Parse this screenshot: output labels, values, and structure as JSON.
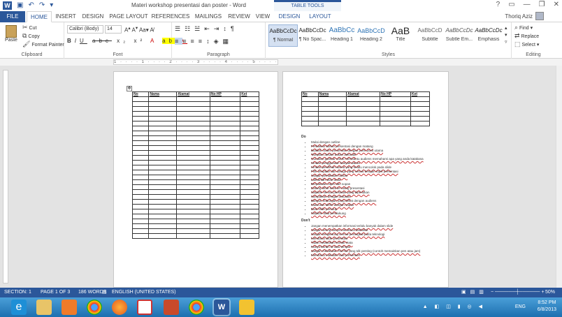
{
  "window": {
    "title": "Materi workshop presentasi dan poster - Word",
    "contextual_tab_group": "TABLE TOOLS",
    "controls": [
      "?",
      "▭",
      "—",
      "❐",
      "✕"
    ]
  },
  "qat": [
    "save-icon",
    "undo-icon",
    "redo-icon",
    "customize-icon"
  ],
  "tabs": {
    "file": "FILE",
    "items": [
      "HOME",
      "INSERT",
      "DESIGN",
      "PAGE LAYOUT",
      "REFERENCES",
      "MAILINGS",
      "REVIEW",
      "VIEW"
    ],
    "contextual": [
      "DESIGN",
      "LAYOUT"
    ]
  },
  "user": {
    "name": "Thoriq Aziz"
  },
  "clipboard": {
    "paste": "Paste",
    "cut": "Cut",
    "copy": "Copy",
    "format_painter": "Format Painter",
    "label": "Clipboard"
  },
  "font": {
    "name": "Calibri (Body)",
    "size": "14",
    "label": "Font"
  },
  "paragraph": {
    "label": "Paragraph"
  },
  "styles": {
    "label": "Styles",
    "items": [
      {
        "sample": "AaBbCcDc",
        "name": "¶ Normal"
      },
      {
        "sample": "AaBbCcDc",
        "name": "¶ No Spac..."
      },
      {
        "sample": "AaBbCc",
        "name": "Heading 1"
      },
      {
        "sample": "AaBbCcD",
        "name": "Heading 2"
      },
      {
        "sample": "AaB",
        "name": "Title"
      },
      {
        "sample": "AaBbCcD",
        "name": "Subtitle"
      },
      {
        "sample": "AaBbCcDc",
        "name": "Subtle Em..."
      },
      {
        "sample": "AaBbCcDc",
        "name": "Emphasis"
      }
    ]
  },
  "editing": {
    "find": "Find",
    "replace": "Replace",
    "select": "Select",
    "label": "Editing"
  },
  "ruler": "1 · · · · 1 · · · · 2 · · · · 3 · · · · 4 · · · · 5 · · · · 6 · · · · 7",
  "table": {
    "headers": [
      "No",
      "Nama",
      "Alamat",
      "No HP",
      "Ket"
    ]
  },
  "do": {
    "heading": "Do",
    "items": [
      "Mulai dengan outline",
      "Perbaikan bahan presentasi dengan matang",
      "Buatlah materi presentasi dengan point point utama",
      "Tampilan desain bukan dekoratif",
      "Gunakan gambar untuk membantu audiens memahami apa yang anda katakana",
      "Hindari penggunaan banyak warna",
      "Hindari pemilihan warna yang terlalu mencolok pada slide",
      "Pilih template dan design yang sesuai dengan topik presentasi",
      "Jangan pemakaian tulisan",
      "Latihanlah slide anda",
      "Berpakaian rapih dan sopan",
      "Datang lebih awal ke ruang presentasi",
      "Siapkan semua perkakas yang diperlukan",
      "Sampaikan dengan antusias",
      "Bangun hubungan yang dekat dengan audiens",
      "Mulai dan akhiri dengan sopan",
      "Buat slide penutup",
      "Siapkan data pendukung"
    ]
  },
  "dont": {
    "heading": "Don't",
    "items": [
      "Jangan menempatkan informasi terlalu banyak dalam slide",
      "Jangan sering hanya membaca flashdisk",
      "Jangan bergantung semua perangkat pada teknologi",
      "Membaca slide presentasi",
      "Tidak melakukan kontak mata",
      "Hanya berdiri di satu tempat",
      "Jangan melakukan hal-hal yang tdk penting (contoh memainkan pen atau jam)",
      "Membaca makalah saat presentasi"
    ]
  },
  "status": {
    "section": "SECTION: 1",
    "page": "PAGE 1 OF 3",
    "words": "186 WORDS",
    "language": "ENGLISH (UNITED STATES)",
    "zoom": "50%"
  },
  "taskbar": {
    "time": "8:52 PM",
    "date": "6/8/2013",
    "lang": "ENG"
  },
  "colors": {
    "accent": "#2b579a",
    "taskbar": "#1d6fb0"
  }
}
